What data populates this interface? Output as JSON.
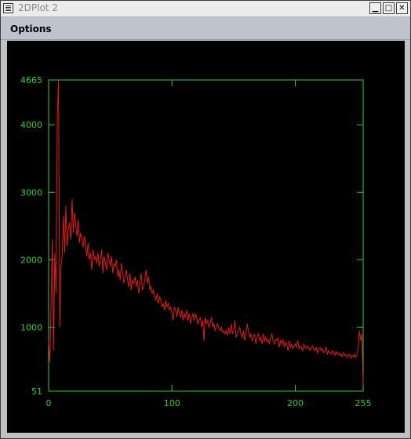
{
  "window": {
    "title": "2DPlot 2",
    "minimize_label": "▁",
    "maximize_label": "□",
    "close_label": "✕"
  },
  "menu": {
    "options_label": "Options"
  },
  "colors": {
    "plot_background": "#000000",
    "axes": "#33cc33",
    "series": "#e01b1b"
  },
  "chart_data": {
    "type": "line",
    "title": "",
    "xlabel": "",
    "ylabel": "",
    "xlim": [
      0,
      255
    ],
    "ylim": [
      51,
      4665
    ],
    "x_ticks": [
      0,
      100,
      200,
      255
    ],
    "x_tick_labels": [
      "0",
      "100",
      "200",
      "255"
    ],
    "y_ticks": [
      51,
      1000,
      2000,
      3000,
      4000,
      4665
    ],
    "y_tick_labels": [
      "51",
      "1000",
      "2000",
      "3000",
      "4000",
      "4665"
    ],
    "grid": false,
    "series": [
      {
        "values": [
          800,
          480,
          1400,
          2300,
          650,
          2100,
          1500,
          4100,
          4665,
          1000,
          1900,
          2050,
          2650,
          2100,
          2800,
          2200,
          2450,
          2550,
          2300,
          2900,
          2400,
          2700,
          2500,
          2350,
          2600,
          2250,
          2400,
          2300,
          2180,
          2350,
          2200,
          2050,
          2250,
          2000,
          2100,
          1850,
          2150,
          2000,
          2050,
          1950,
          2100,
          1900,
          2000,
          2150,
          1800,
          2050,
          1950,
          1850,
          2100,
          2000,
          1900,
          2050,
          1800,
          1950,
          1900,
          2000,
          1750,
          1850,
          1700,
          1950,
          1800,
          1650,
          1750,
          1850,
          1700,
          1600,
          1800,
          1550,
          1700,
          1650,
          1750,
          1600,
          1700,
          1500,
          1650,
          1800,
          1550,
          1600,
          1700,
          1850,
          1650,
          1750,
          1550,
          1600,
          1500,
          1550,
          1450,
          1400,
          1500,
          1350,
          1450,
          1400,
          1300,
          1350,
          1250,
          1400,
          1300,
          1350,
          1250,
          1300,
          1200,
          1100,
          1300,
          1250,
          1150,
          1300,
          1200,
          1150,
          1250,
          1100,
          1200,
          1150,
          1250,
          1100,
          1200,
          1050,
          1150,
          1200,
          1100,
          1200,
          1150,
          1050,
          1100,
          1150,
          1000,
          1100,
          800,
          1150,
          1050,
          1100,
          1000,
          1050,
          1150,
          1000,
          1050,
          950,
          1000,
          1050,
          980,
          950,
          1000,
          920,
          950,
          900,
          950,
          880,
          1000,
          900,
          1050,
          900,
          950,
          1100,
          850,
          900,
          950,
          1000,
          900,
          850,
          950,
          800,
          900,
          1050,
          950,
          850,
          900,
          800,
          850,
          900,
          750,
          850,
          900,
          800,
          850,
          750,
          900,
          800,
          850,
          780,
          820,
          750,
          850,
          900,
          800,
          750,
          820,
          800,
          850,
          700,
          800,
          750,
          820,
          700,
          780,
          750,
          650,
          800,
          700,
          750,
          680,
          720,
          750,
          700,
          800,
          680,
          720,
          700,
          650,
          750,
          700,
          680,
          720,
          700,
          650,
          700,
          720,
          680,
          650,
          700,
          620,
          680,
          700,
          650,
          680,
          620,
          650,
          700,
          600,
          650,
          620,
          600,
          650,
          620,
          580,
          640,
          600,
          620,
          580,
          600,
          560,
          620,
          580,
          600,
          550,
          580,
          600,
          540,
          580,
          560,
          600,
          550,
          600,
          700,
          950,
          800,
          900,
          150
        ]
      }
    ]
  }
}
